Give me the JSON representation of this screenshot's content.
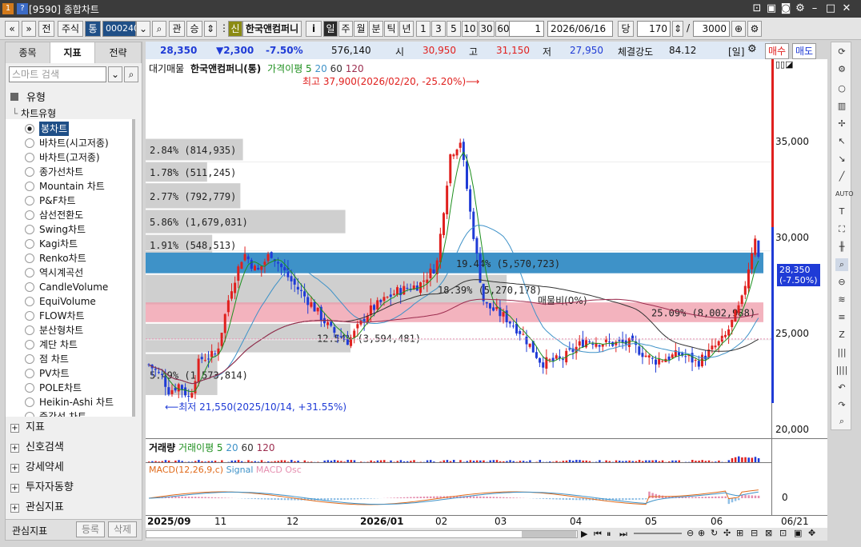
{
  "window": {
    "num1": "1",
    "num2": "?",
    "title": "[9590] 종합차트"
  },
  "toolbar": {
    "nav_prev": "«",
    "nav_menu": "»",
    "jeon": "전",
    "market": "주식",
    "tong": "통",
    "code": "000240",
    "gwan": "관",
    "seung": "승",
    "shin": "신",
    "stock_name": "한국앤컴퍼니",
    "info": "i",
    "periods": [
      "일",
      "주",
      "월",
      "분",
      "틱",
      "년"
    ],
    "intervals": [
      "1",
      "3",
      "5",
      "10",
      "30",
      "60"
    ],
    "count_sel": "1",
    "date": "2026/06/16",
    "dang": "당",
    "bars": "170",
    "slash": "/",
    "total": "3000"
  },
  "left": {
    "tabs": [
      "종목",
      "지표",
      "전략"
    ],
    "search_placeholder": "스마트 검색",
    "section_type": "유형",
    "subtree": "차트유형",
    "chart_types": [
      "봉차트",
      "바차트(시고저종)",
      "바차트(고저종)",
      "종가선차트",
      "Mountain 차트",
      "P&F차트",
      "삼선전환도",
      "Swing차트",
      "Kagi차트",
      "Renko차트",
      "역시계곡선",
      "CandleVolume",
      "EquiVolume",
      "FLOW차트",
      "분산형차트",
      "계단 차트",
      "점 차트",
      "PV차트",
      "POLE차트",
      "Heikin-Ashi 차트",
      "중간선 차트"
    ],
    "sections": [
      "지표",
      "신호검색",
      "강세약세",
      "투자자동향",
      "관심지표"
    ],
    "footer_label": "관심지표",
    "btn_register": "등록",
    "btn_delete": "삭제"
  },
  "info": {
    "price": "28,350",
    "change": "▼2,300",
    "pct": "-7.50%",
    "volume": "576,140",
    "open_l": "시",
    "open": "30,950",
    "high_l": "고",
    "high": "31,150",
    "low_l": "저",
    "low": "27,950",
    "strength_l": "체결강도",
    "strength": "84.12",
    "period_l": "[일]",
    "buy": "매수",
    "sell": "매도"
  },
  "legend": {
    "items": [
      "대기매물",
      "한국앤컴퍼니(통)",
      "가격이평 5",
      "20",
      "60",
      "120"
    ]
  },
  "annotations": {
    "high": "최고 37,900(2026/02/20, -25.20%)⟶",
    "low": "⟵최저 21,550(2025/10/14, +31.55%)"
  },
  "price_badge": {
    "price": "28,350",
    "pct": "(-7.50%)"
  },
  "yaxis": [
    "35,000",
    "30,000",
    "25,000",
    "20,000"
  ],
  "volume_profile": [
    {
      "label": "2.84% (814,935)",
      "frac": 0.38
    },
    {
      "label": "1.78% (511,245)",
      "frac": 0.24
    },
    {
      "label": "2.77% (792,779)",
      "frac": 0.37
    },
    {
      "label": "5.86% (1,679,031)",
      "frac": 0.78
    },
    {
      "label": "1.91% (548,513)",
      "frac": 0.26
    },
    {
      "label": "19.44% (5,570,723)",
      "frac": 1.0
    },
    {
      "label": "18.39% (5,270,178)",
      "frac": 0.96
    },
    {
      "label": "25.09% (8,002,988)",
      "frac": 1.0
    },
    {
      "label": "12.54% (3,594,481)",
      "frac": 0.8
    },
    {
      "label": "5.49% (1,573,814)",
      "frac": 0.28
    }
  ],
  "bpr_label": "매물비(0%)",
  "vol_legend": [
    "거래량",
    "거래이평 5",
    "20",
    "60",
    "120"
  ],
  "macd_legend": [
    "MACD(12,26,9,c)",
    "Signal",
    "MACD Osc"
  ],
  "macd_zero": "0",
  "xaxis": [
    "2025/09",
    "11",
    "12",
    "2026/01",
    "02",
    "03",
    "04",
    "05",
    "06"
  ],
  "xaxis_date": "06/21",
  "colors": {
    "up": "#e0201e",
    "down": "#1f3bd6",
    "profile_blue": "#3e92c8",
    "profile_pink": "#ef9aa8",
    "profile_gray": "#cfcfcf"
  }
}
